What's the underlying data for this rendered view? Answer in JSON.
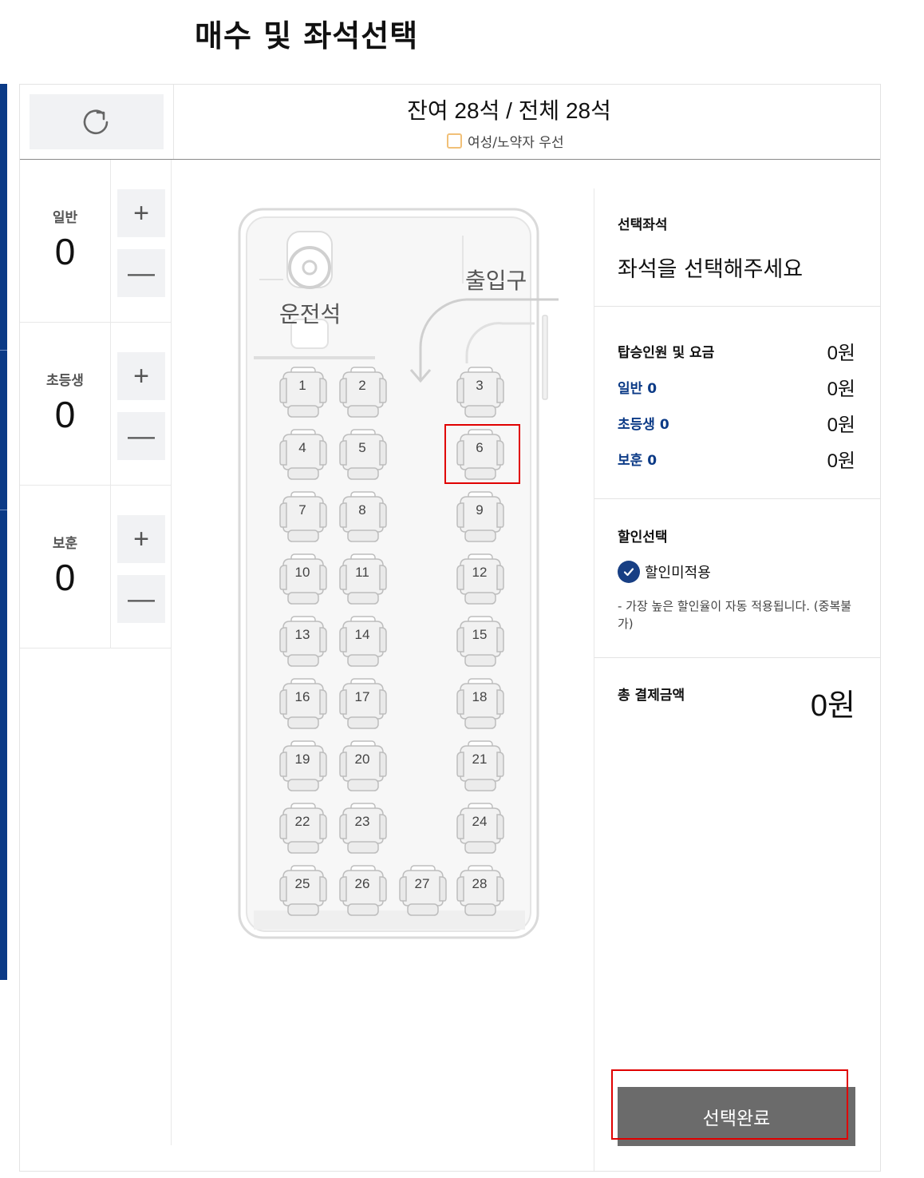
{
  "page_title": "매수 및 좌석선택",
  "header": {
    "seat_status": "잔여 28석 / 전체 28석",
    "priority_label": "여성/노약자 우선"
  },
  "counters": [
    {
      "label": "일반",
      "value": "0",
      "plus": "+",
      "minus": "—"
    },
    {
      "label": "초등생",
      "value": "0",
      "plus": "+",
      "minus": "—"
    },
    {
      "label": "보훈",
      "value": "0",
      "plus": "+",
      "minus": "—"
    }
  ],
  "bus": {
    "driver_label": "운전석",
    "door_label": "출입구",
    "seats": [
      "1",
      "2",
      "3",
      "4",
      "5",
      "6",
      "7",
      "8",
      "9",
      "10",
      "11",
      "12",
      "13",
      "14",
      "15",
      "16",
      "17",
      "18",
      "19",
      "20",
      "21",
      "22",
      "23",
      "24",
      "25",
      "26",
      "27",
      "28"
    ]
  },
  "right_panel": {
    "selected_title": "선택좌석",
    "selected_placeholder": "좌석을 선택해주세요",
    "fare_title": "탑승인원 및 요금",
    "fare_total": "0원",
    "fares": [
      {
        "label": "일반 0",
        "value": "0원"
      },
      {
        "label": "초등생 0",
        "value": "0원"
      },
      {
        "label": "보훈 0",
        "value": "0원"
      }
    ],
    "discount_title": "할인선택",
    "discount_option": "할인미적용",
    "discount_note": "- 가장 높은 할인율이 자동 적용됩니다. (중복불가)",
    "total_label": "총 결제금액",
    "total_value": "0원",
    "complete_button": "선택완료"
  },
  "colors": {
    "accent": "#0b3a86",
    "highlight": "#e00000",
    "button": "#6b6b6b"
  }
}
